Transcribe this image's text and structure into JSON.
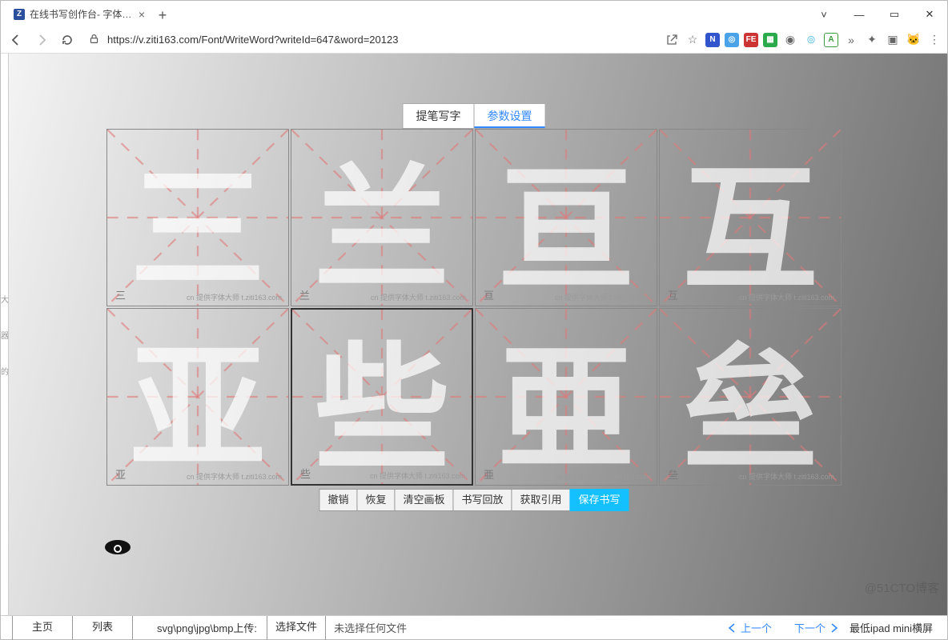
{
  "browser": {
    "tab_title": "在线书写创作台- 字体大师",
    "url": "https://v.ziti163.com/Font/WriteWord?writeId=647&word=20123"
  },
  "tabs": {
    "write": "提笔写字",
    "params": "参数设置"
  },
  "cells": [
    {
      "glyph": "三",
      "label": "三"
    },
    {
      "glyph": "兰",
      "label": "兰"
    },
    {
      "glyph": "亘",
      "label": "亘"
    },
    {
      "glyph": "互",
      "label": "互"
    },
    {
      "glyph": "亚",
      "label": "亚"
    },
    {
      "glyph": "些",
      "label": "些",
      "active": true
    },
    {
      "glyph": "亜",
      "label": "亜"
    },
    {
      "glyph": "亝",
      "label": "亝"
    }
  ],
  "cell_watermark": "cn 提供字体大师 t.ziti163.com",
  "actions": {
    "undo": "撤销",
    "redo": "恢复",
    "clear": "清空画板",
    "replay": "书写回放",
    "quote": "获取引用",
    "save": "保存书写"
  },
  "bottom": {
    "home": "主页",
    "list": "列表",
    "upload_label": "svg\\png\\jpg\\bmp上传:",
    "choose_file": "选择文件",
    "no_file": "未选择任何文件",
    "prev": "上一个",
    "next": "下一个",
    "min_device": "最低ipad mini横屏"
  },
  "watermark": "@51CTO博客"
}
